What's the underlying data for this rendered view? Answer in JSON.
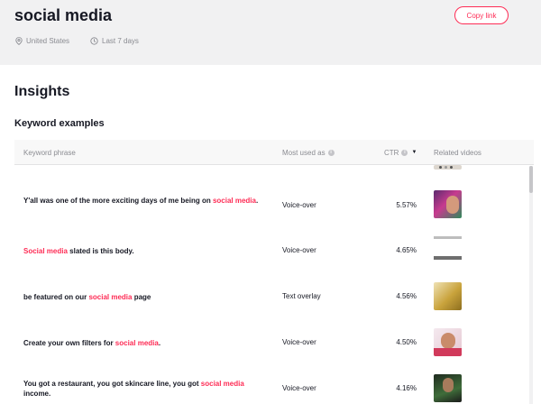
{
  "header": {
    "title": "social media",
    "copy_label": "Copy link",
    "location": "United States",
    "period": "Last 7 days"
  },
  "insights_title": "Insights",
  "section_title": "Keyword examples",
  "table": {
    "columns": {
      "phrase": "Keyword phrase",
      "used": "Most used as",
      "ctr": "CTR",
      "videos": "Related videos"
    },
    "rows": [
      {
        "pre": "Y'all was one of the more exciting days of me being on ",
        "hl": "social media",
        "post": ".",
        "used": "Voice-over",
        "ctr": "5.57%"
      },
      {
        "pre": "",
        "hl": "Social media",
        "post": " slated is this body.",
        "used": "Voice-over",
        "ctr": "4.65%"
      },
      {
        "pre": "be featured on our ",
        "hl": "social media",
        "post": " page",
        "used": "Text overlay",
        "ctr": "4.56%"
      },
      {
        "pre": "Create your own filters for ",
        "hl": "social media",
        "post": ".",
        "used": "Voice-over",
        "ctr": "4.50%"
      },
      {
        "pre": "You got a restaurant, you got skincare line, you got ",
        "hl": "social media",
        "post": " income.",
        "used": "Voice-over",
        "ctr": "4.16%"
      }
    ]
  },
  "colors": {
    "accent": "#fe2c55",
    "muted": "#8a8b91",
    "header_bg": "#f1f1f2"
  },
  "icons": {
    "location": "location-pin-icon",
    "period": "clock-icon",
    "sort": "sort-down-icon",
    "info": "info-icon"
  }
}
